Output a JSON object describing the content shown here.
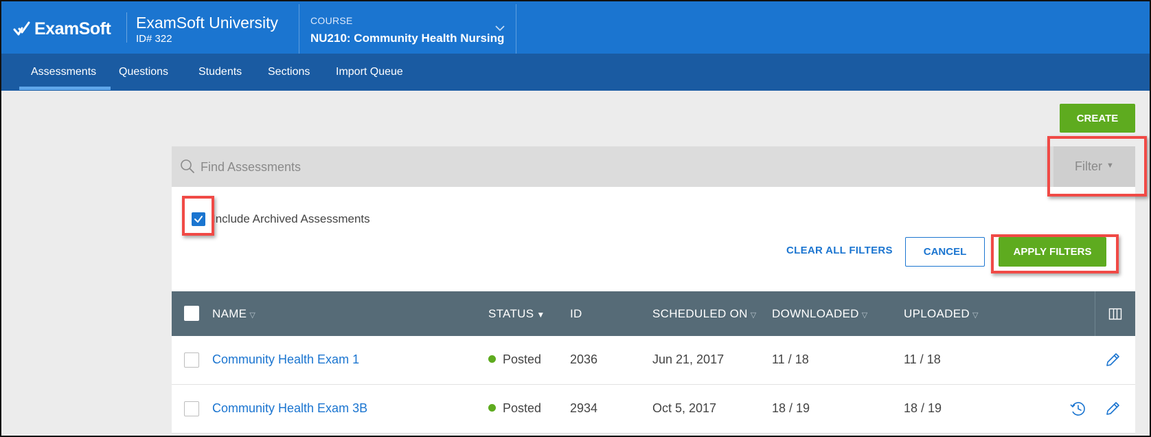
{
  "app": {
    "logo_text": "ExamSoft",
    "university_name": "ExamSoft University",
    "university_id": "ID# 322"
  },
  "course": {
    "label": "COURSE",
    "value": "NU210: Community Health Nursing"
  },
  "nav": {
    "items": [
      {
        "label": "Assessments",
        "active": true
      },
      {
        "label": "Questions"
      },
      {
        "label": "Students"
      },
      {
        "label": "Sections"
      },
      {
        "label": "Import Queue"
      }
    ]
  },
  "toolbar": {
    "create_label": "CREATE"
  },
  "search": {
    "placeholder": "Find Assessments",
    "value": ""
  },
  "filter": {
    "button_label": "Filter",
    "include_archived_label": "Include Archived Assessments",
    "include_archived_checked": true,
    "clear_all_label": "CLEAR ALL FILTERS",
    "cancel_label": "CANCEL",
    "apply_label": "APPLY FILTERS"
  },
  "table": {
    "columns": [
      "NAME",
      "STATUS",
      "ID",
      "SCHEDULED ON",
      "DOWNLOADED",
      "UPLOADED"
    ],
    "rows": [
      {
        "name": "Community Health Exam 1",
        "status": "Posted",
        "id": "2036",
        "scheduled_on": "Jun 21, 2017",
        "downloaded": "11 / 18",
        "uploaded": "11 / 18",
        "has_schedule_icon": false
      },
      {
        "name": "Community Health Exam 3B",
        "status": "Posted",
        "id": "2934",
        "scheduled_on": "Oct 5, 2017",
        "downloaded": "18 / 19",
        "uploaded": "18 / 19",
        "has_schedule_icon": true
      }
    ]
  },
  "colors": {
    "header_blue": "#1b75d0",
    "nav_blue": "#1a5ba2",
    "green": "#5eab1f",
    "table_header": "#566b77",
    "highlight_red": "#f04a46"
  }
}
